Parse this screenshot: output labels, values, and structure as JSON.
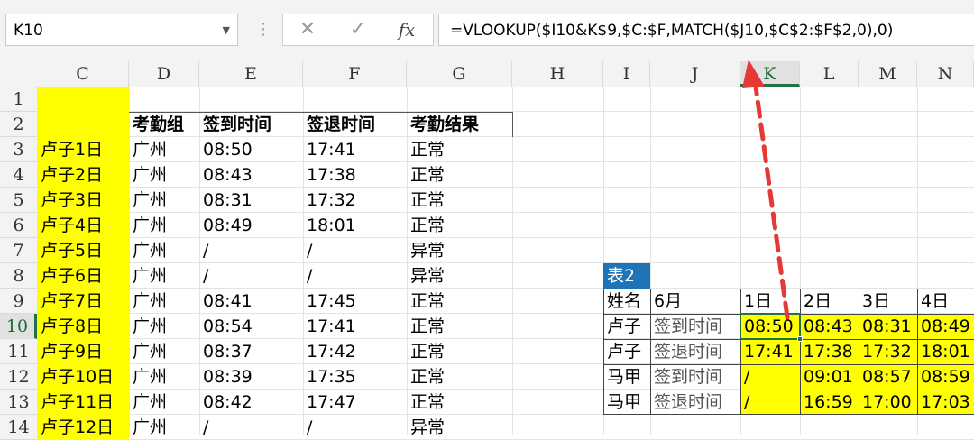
{
  "namebox": {
    "value": "K10"
  },
  "formula_bar": {
    "cancel_icon": "close-icon",
    "enter_icon": "check-icon",
    "fx_label": "fx",
    "formula": "=VLOOKUP($I10&K$9,$C:$F,MATCH($J10,$C$2:$F$2,0),0)"
  },
  "columns": [
    "C",
    "D",
    "E",
    "F",
    "G",
    "H",
    "I",
    "J",
    "K",
    "L",
    "M",
    "N"
  ],
  "active_column": "K",
  "rows": [
    "1",
    "2",
    "3",
    "4",
    "5",
    "6",
    "7",
    "8",
    "9",
    "10",
    "11",
    "12",
    "13",
    "14"
  ],
  "active_row": "10",
  "table1": {
    "headers": [
      "考勤组",
      "签到时间",
      "签退时间",
      "考勤结果"
    ],
    "rows": [
      [
        "卢子1日",
        "广州",
        "08:50",
        "17:41",
        "正常"
      ],
      [
        "卢子2日",
        "广州",
        "08:43",
        "17:38",
        "正常"
      ],
      [
        "卢子3日",
        "广州",
        "08:31",
        "17:32",
        "正常"
      ],
      [
        "卢子4日",
        "广州",
        "08:49",
        "18:01",
        "正常"
      ],
      [
        "卢子5日",
        "广州",
        "/",
        "/",
        "异常"
      ],
      [
        "卢子6日",
        "广州",
        "/",
        "/",
        "异常"
      ],
      [
        "卢子7日",
        "广州",
        "08:41",
        "17:45",
        "正常"
      ],
      [
        "卢子8日",
        "广州",
        "08:54",
        "17:41",
        "正常"
      ],
      [
        "卢子9日",
        "广州",
        "08:37",
        "17:42",
        "正常"
      ],
      [
        "卢子10日",
        "广州",
        "08:39",
        "17:35",
        "正常"
      ],
      [
        "卢子11日",
        "广州",
        "08:42",
        "17:47",
        "正常"
      ],
      [
        "卢子12日",
        "广州",
        "/",
        "/",
        "异常"
      ]
    ]
  },
  "table2": {
    "label": "表2",
    "headers": [
      "姓名",
      "6月",
      "1日",
      "2日",
      "3日",
      "4日"
    ],
    "rows": [
      [
        "卢子",
        "签到时间",
        "08:50",
        "08:43",
        "08:31",
        "08:49"
      ],
      [
        "卢子",
        "签退时间",
        "17:41",
        "17:38",
        "17:32",
        "18:01"
      ],
      [
        "马甲",
        "签到时间",
        "/",
        "09:01",
        "08:57",
        "08:59"
      ],
      [
        "马甲",
        "签退时间",
        "/",
        "16:59",
        "17:00",
        "17:03"
      ]
    ]
  },
  "colors": {
    "highlight": "#ffff00",
    "table_label_bg": "#1f73b7",
    "select_green": "#217346",
    "arrow": "#e53935"
  }
}
